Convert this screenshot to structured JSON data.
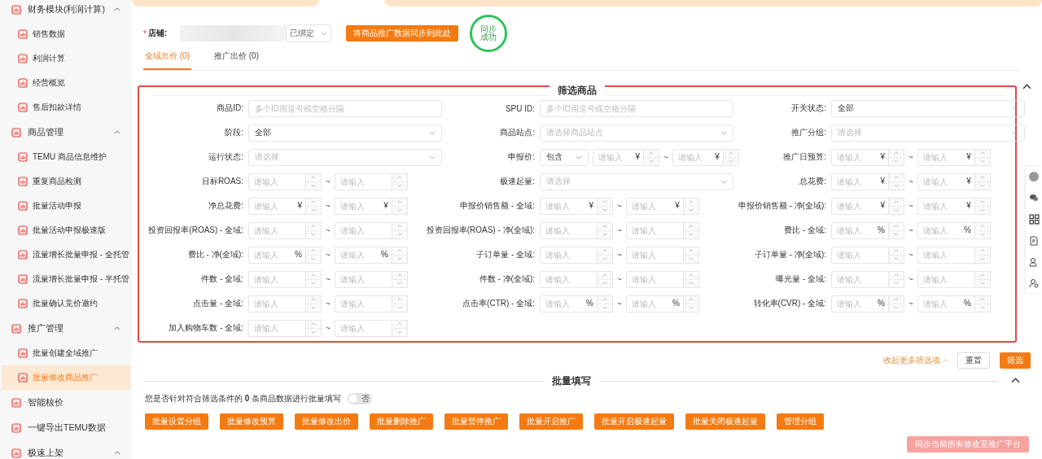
{
  "sidebar": {
    "groups": [
      {
        "label": "财务模块(利润计算)",
        "expanded": true,
        "children": [
          {
            "label": "销售数据",
            "selected": false
          },
          {
            "label": "利润计算",
            "selected": false
          },
          {
            "label": "经营概览",
            "selected": false
          },
          {
            "label": "售后扣款详情",
            "selected": false
          }
        ]
      },
      {
        "label": "商品管理",
        "expanded": true,
        "children": [
          {
            "label": "TEMU 商品信息维护",
            "selected": false
          },
          {
            "label": "重复商品检测",
            "selected": false
          },
          {
            "label": "批量活动申报",
            "selected": false
          },
          {
            "label": "批量活动申报极速版",
            "selected": false
          },
          {
            "label": "流量增长批量申报 - 全托管",
            "selected": false
          },
          {
            "label": "流量增长批量申报 - 半托管",
            "selected": false
          },
          {
            "label": "批量确认竞价邀约",
            "selected": false
          }
        ]
      },
      {
        "label": "推广管理",
        "expanded": true,
        "children": [
          {
            "label": "批量创建全域推广",
            "selected": false
          },
          {
            "label": "批量修改商品推广",
            "selected": true
          }
        ]
      },
      {
        "label": "智能核价"
      },
      {
        "label": "一键导出TEMU数据"
      },
      {
        "label": "极速上架",
        "expanded": true
      }
    ]
  },
  "store": {
    "required_mark": "*",
    "label": "店铺:",
    "binding": "已绑定",
    "sync_button": "将商品推广数据同步到此处",
    "status": "同步成功"
  },
  "tabs": [
    {
      "label": "全域出价 (0)",
      "selected": true
    },
    {
      "label": "推广出价 (0)",
      "selected": false
    }
  ],
  "filter": {
    "title": "筛选商品",
    "expanded": true,
    "fields": [
      {
        "label": "商品ID:",
        "kind": "text",
        "placeholder": "多个ID用逗号或空格分隔"
      },
      {
        "label": "SPU ID:",
        "kind": "text",
        "placeholder": "多个ID用逗号或空格分隔"
      },
      {
        "label": "开关状态:",
        "kind": "select",
        "value": "全部"
      },
      {
        "label": "阶段:",
        "kind": "select",
        "value": "全部"
      },
      {
        "label": "商品站点:",
        "kind": "select",
        "placeholder": "请选择商品站点"
      },
      {
        "label": "推广分组:",
        "kind": "select",
        "placeholder": "请选择"
      },
      {
        "label": "运行状态:",
        "kind": "select",
        "placeholder": "请选择"
      },
      {
        "label": "申报价:",
        "kind": "price",
        "mode": "包含",
        "unit": "¥",
        "min_placeholder": "请输入",
        "separator": "~",
        "max_placeholder": "请输入"
      },
      {
        "label": "推广日预算:",
        "kind": "range",
        "unit": "¥",
        "min_placeholder": "请输入",
        "separator": "~",
        "max_placeholder": "请输入"
      },
      {
        "label": "目标ROAS:",
        "kind": "range",
        "min_placeholder": "请输入",
        "separator": "~",
        "max_placeholder": "请输入"
      },
      {
        "label": "极速起量:",
        "kind": "select",
        "placeholder": "请选择"
      },
      {
        "label": "总花费:",
        "kind": "range",
        "unit": "¥",
        "min_placeholder": "请输入",
        "separator": "~",
        "max_placeholder": "请输入"
      },
      {
        "label": "净总花费:",
        "kind": "range",
        "unit": "¥",
        "min_placeholder": "请输入",
        "separator": "~",
        "max_placeholder": "请输入"
      },
      {
        "label": "申报价销售额 - 全域:",
        "kind": "range",
        "unit": "¥",
        "min_placeholder": "请输入",
        "separator": "~",
        "max_placeholder": "请输入"
      },
      {
        "label": "申报价销售额 - 净(全域):",
        "kind": "range",
        "unit": "¥",
        "min_placeholder": "请输入",
        "separator": "~",
        "max_placeholder": "请输入"
      },
      {
        "label": "投资回报率(ROAS) - 全域:",
        "kind": "range",
        "min_placeholder": "请输入",
        "separator": "~",
        "max_placeholder": "请输入"
      },
      {
        "label": "投资回报率(ROAS) - 净(全域):",
        "kind": "range",
        "min_placeholder": "请输入",
        "separator": "~",
        "max_placeholder": "请输入"
      },
      {
        "label": "费比 - 全域:",
        "kind": "range",
        "unit": "%",
        "min_placeholder": "请输入",
        "separator": "~",
        "max_placeholder": "请输入"
      },
      {
        "label": "费比 - 净(全域):",
        "kind": "range",
        "unit": "%",
        "min_placeholder": "请输入",
        "separator": "~",
        "max_placeholder": "请输入"
      },
      {
        "label": "子订单量 - 全域:",
        "kind": "range",
        "min_placeholder": "请输入",
        "separator": "~",
        "max_placeholder": "请输入"
      },
      {
        "label": "子订单量 - 净(全域):",
        "kind": "range",
        "min_placeholder": "请输入",
        "separator": "~",
        "max_placeholder": "请输入"
      },
      {
        "label": "件数 - 全域:",
        "kind": "range",
        "min_placeholder": "请输入",
        "separator": "~",
        "max_placeholder": "请输入"
      },
      {
        "label": "件数 - 净(全域):",
        "kind": "range",
        "min_placeholder": "请输入",
        "separator": "~",
        "max_placeholder": "请输入"
      },
      {
        "label": "曝光量 - 全域:",
        "kind": "range",
        "min_placeholder": "请输入",
        "separator": "~",
        "max_placeholder": "请输入"
      },
      {
        "label": "点击量 - 全域:",
        "kind": "range",
        "min_placeholder": "请输入",
        "separator": "~",
        "max_placeholder": "请输入"
      },
      {
        "label": "点击率(CTR) - 全域:",
        "kind": "range",
        "unit": "%",
        "min_placeholder": "请输入",
        "separator": "~",
        "max_placeholder": "请输入"
      },
      {
        "label": "转化率(CVR) - 全域:",
        "kind": "range",
        "unit": "%",
        "min_placeholder": "请输入",
        "separator": "~",
        "max_placeholder": "请输入"
      },
      {
        "label": "加入购物车数 - 全域:",
        "kind": "range",
        "min_placeholder": "请输入",
        "separator": "~",
        "max_placeholder": "请输入"
      }
    ]
  },
  "filter_actions": {
    "collapse_link": "收起更多筛选项",
    "reset": "重置",
    "submit": "筛选"
  },
  "batch": {
    "title": "批量填写",
    "expanded": true,
    "question": "您是否针对符合筛选条件的 **0** 条商品数据进行批量填写",
    "toggle": {
      "on": false,
      "label": "否"
    },
    "buttons": [
      "批量设置分组",
      "批量修改预算",
      "批量修改出价",
      "批量删除推广",
      "批量暂停推广",
      "批量开启推广",
      "批量开启极速起量",
      "批量关闭极速起量",
      "管理分组"
    ],
    "sync_all": {
      "label": "同步当前所有修改至推广平台",
      "disabled": true
    }
  }
}
